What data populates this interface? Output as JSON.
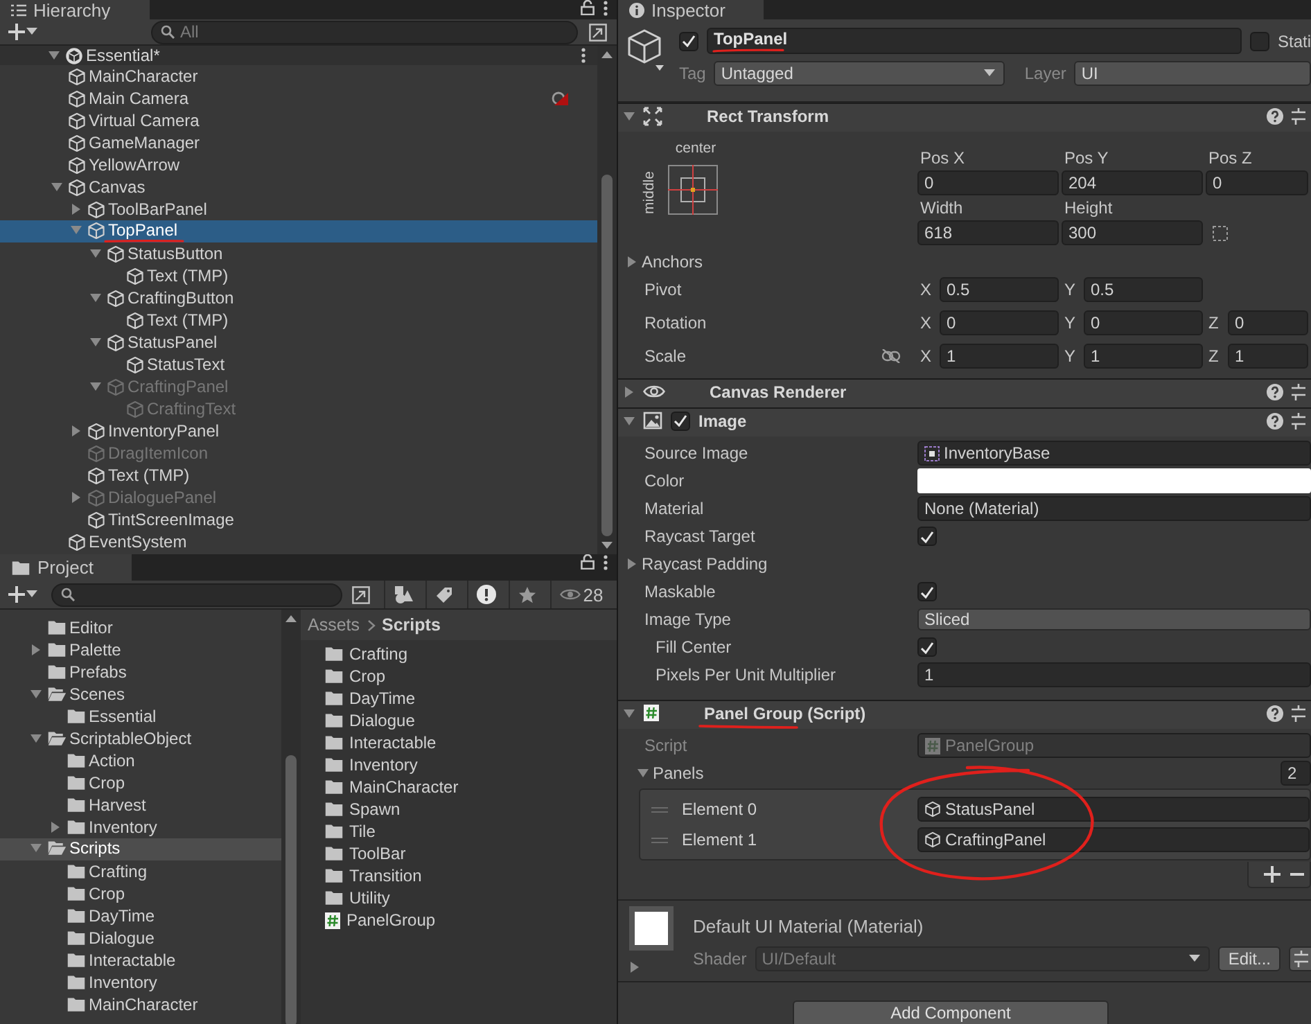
{
  "hierarchy": {
    "tab": "Hierarchy",
    "search": {
      "placeholder": "All"
    },
    "scene": {
      "name": "Essential*",
      "expanded": true
    },
    "items": [
      {
        "name": "MainCharacter",
        "selected": false,
        "disabled": false
      },
      {
        "name": "Main Camera",
        "selected": false,
        "disabled": false,
        "marker": true
      },
      {
        "name": "Virtual Camera",
        "selected": false,
        "disabled": false
      },
      {
        "name": "GameManager",
        "selected": false,
        "disabled": false
      },
      {
        "name": "YellowArrow",
        "selected": false,
        "disabled": false
      },
      {
        "name": "Canvas",
        "selected": false,
        "disabled": false,
        "expanded": true,
        "children": [
          {
            "name": "ToolBarPanel",
            "selected": false,
            "disabled": false,
            "expanded": false
          },
          {
            "name": "TopPanel",
            "selected": true,
            "disabled": false,
            "expanded": true,
            "children": [
              {
                "name": "StatusButton",
                "selected": false,
                "disabled": false,
                "expanded": true,
                "children": [
                  {
                    "name": "Text (TMP)",
                    "selected": false,
                    "disabled": false
                  }
                ]
              },
              {
                "name": "CraftingButton",
                "selected": false,
                "disabled": false,
                "expanded": true,
                "children": [
                  {
                    "name": "Text (TMP)",
                    "selected": false,
                    "disabled": false
                  }
                ]
              },
              {
                "name": "StatusPanel",
                "selected": false,
                "disabled": false,
                "expanded": true,
                "children": [
                  {
                    "name": "StatusText",
                    "selected": false,
                    "disabled": false
                  }
                ]
              },
              {
                "name": "CraftingPanel",
                "selected": false,
                "disabled": true,
                "expanded": true,
                "children": [
                  {
                    "name": "CraftingText",
                    "selected": false,
                    "disabled": true
                  }
                ]
              }
            ]
          },
          {
            "name": "InventoryPanel",
            "selected": false,
            "disabled": false,
            "expanded": false
          },
          {
            "name": "DragItemIcon",
            "selected": false,
            "disabled": true
          },
          {
            "name": "Text (TMP)",
            "selected": false,
            "disabled": false
          },
          {
            "name": "DialoguePanel",
            "selected": false,
            "disabled": true,
            "expanded": false
          },
          {
            "name": "TintScreenImage",
            "selected": false,
            "disabled": false
          }
        ]
      },
      {
        "name": "EventSystem",
        "selected": false,
        "disabled": false
      }
    ]
  },
  "project": {
    "tab": "Project",
    "hidden_count": "28",
    "tree": [
      {
        "name": "Editor",
        "selected": false
      },
      {
        "name": "Palette",
        "selected": false,
        "expanded": false
      },
      {
        "name": "Prefabs",
        "selected": false
      },
      {
        "name": "Scenes",
        "selected": false,
        "expanded": true,
        "children": [
          {
            "name": "Essential",
            "selected": false
          }
        ]
      },
      {
        "name": "ScriptableObject",
        "selected": false,
        "expanded": true,
        "children": [
          {
            "name": "Action",
            "selected": false
          },
          {
            "name": "Crop",
            "selected": false
          },
          {
            "name": "Harvest",
            "selected": false
          },
          {
            "name": "Inventory",
            "selected": false,
            "expanded": false
          }
        ]
      },
      {
        "name": "Scripts",
        "selected": true,
        "expanded": true,
        "children": [
          {
            "name": "Crafting",
            "selected": false
          },
          {
            "name": "Crop",
            "selected": false
          },
          {
            "name": "DayTime",
            "selected": false
          },
          {
            "name": "Dialogue",
            "selected": false
          },
          {
            "name": "Interactable",
            "selected": false
          },
          {
            "name": "Inventory",
            "selected": false
          },
          {
            "name": "MainCharacter",
            "selected": false
          }
        ]
      }
    ],
    "breadcrumb": [
      "Assets",
      "Scripts"
    ],
    "files": [
      {
        "name": "Crafting",
        "kind": "folder"
      },
      {
        "name": "Crop",
        "kind": "folder"
      },
      {
        "name": "DayTime",
        "kind": "folder"
      },
      {
        "name": "Dialogue",
        "kind": "folder"
      },
      {
        "name": "Interactable",
        "kind": "folder"
      },
      {
        "name": "Inventory",
        "kind": "folder"
      },
      {
        "name": "MainCharacter",
        "kind": "folder"
      },
      {
        "name": "Spawn",
        "kind": "folder"
      },
      {
        "name": "Tile",
        "kind": "folder"
      },
      {
        "name": "ToolBar",
        "kind": "folder"
      },
      {
        "name": "Transition",
        "kind": "folder"
      },
      {
        "name": "Utility",
        "kind": "folder"
      },
      {
        "name": "PanelGroup",
        "kind": "script"
      }
    ]
  },
  "inspector": {
    "tab": "Inspector",
    "object": {
      "active": true,
      "name": "TopPanel",
      "static": false,
      "static_label": "Stati",
      "tag_label": "Tag",
      "tag": "Untagged",
      "layer_label": "Layer",
      "layer": "UI"
    },
    "components": [
      {
        "kind": "rect_transform",
        "title": "Rect Transform",
        "expanded": true,
        "anchor_h": "center",
        "anchor_v": "middle",
        "fields": [
          {
            "label": "Pos X",
            "value": "0"
          },
          {
            "label": "Pos Y",
            "value": "204"
          },
          {
            "label": "Pos Z",
            "value": "0"
          },
          {
            "label": "Width",
            "value": "618"
          },
          {
            "label": "Height",
            "value": "300"
          }
        ],
        "anchors": {
          "label": "Anchors",
          "expanded": false
        },
        "vectors": [
          {
            "label": "Pivot",
            "axes": [
              {
                "axis": "X",
                "value": "0.5"
              },
              {
                "axis": "Y",
                "value": "0.5"
              }
            ]
          },
          {
            "label": "Rotation",
            "axes": [
              {
                "axis": "X",
                "value": "0"
              },
              {
                "axis": "Y",
                "value": "0"
              },
              {
                "axis": "Z",
                "value": "0"
              }
            ]
          },
          {
            "label": "Scale",
            "constrained": false,
            "axes": [
              {
                "axis": "X",
                "value": "1"
              },
              {
                "axis": "Y",
                "value": "1"
              },
              {
                "axis": "Z",
                "value": "1"
              }
            ]
          }
        ]
      },
      {
        "kind": "canvas_renderer",
        "title": "Canvas Renderer",
        "expanded": false
      },
      {
        "kind": "image",
        "title": "Image",
        "expanded": true,
        "enabled": true,
        "properties": [
          {
            "kind": "sprite",
            "label": "Source Image",
            "value": "InventoryBase"
          },
          {
            "kind": "color",
            "label": "Color",
            "color": "#ffffff"
          },
          {
            "kind": "field",
            "label": "Material",
            "value": "None (Material)"
          },
          {
            "kind": "checkbox",
            "label": "Raycast Target",
            "checked": true
          },
          {
            "kind": "foldout",
            "label": "Raycast Padding",
            "expanded": false
          },
          {
            "kind": "checkbox",
            "label": "Maskable",
            "checked": true
          },
          {
            "kind": "dropdown",
            "label": "Image Type",
            "value": "Sliced",
            "children": [
              {
                "kind": "checkbox",
                "label": "Fill Center",
                "checked": true
              },
              {
                "kind": "field",
                "label": "Pixels Per Unit Multiplier",
                "value": "1"
              }
            ]
          }
        ]
      },
      {
        "kind": "script",
        "title": "Panel Group (Script)",
        "expanded": true,
        "script_label": "Script",
        "script": "PanelGroup",
        "list": {
          "label": "Panels",
          "expanded": true,
          "count": "2",
          "elements": [
            {
              "label": "Element 0",
              "value": "StatusPanel"
            },
            {
              "label": "Element 1",
              "value": "CraftingPanel"
            }
          ]
        }
      }
    ],
    "material": {
      "name": "Default UI Material (Material)",
      "expanded": false,
      "shader_label": "Shader",
      "shader": "UI/Default",
      "edit": "Edit..."
    },
    "add_component": "Add Component"
  }
}
